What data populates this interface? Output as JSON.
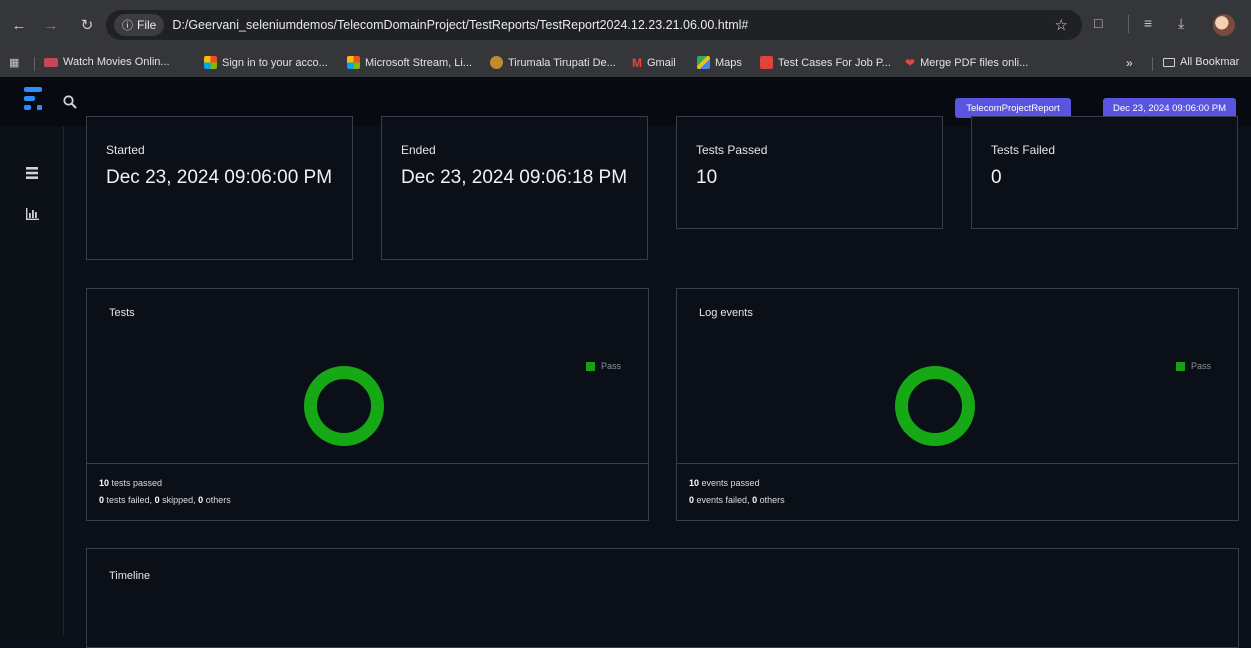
{
  "browser": {
    "file_chip": "File",
    "url": "D:/Geervani_seleniumdemos/TelecomDomainProject/TestReports/TestReport2024.12.23.21.06.00.html#",
    "bookmarks": [
      "Watch Movies Onlin...",
      "Sign in to your acco...",
      "Microsoft Stream, Li...",
      "Tirumala Tirupati De...",
      "Gmail",
      "Maps",
      "Test Cases For Job P...",
      "Merge PDF files onli..."
    ],
    "more_label": "»",
    "all_bookmarks": "All Bookmar"
  },
  "appbar": {
    "report_name": "TelecomProjectReport",
    "report_date": "Dec 23, 2024 09:06:00 PM"
  },
  "stats": {
    "started_label": "Started",
    "started_value": "Dec 23, 2024 09:06:00 PM",
    "ended_label": "Ended",
    "ended_value": "Dec 23, 2024 09:06:18 PM",
    "passed_label": "Tests Passed",
    "passed_value": "10",
    "failed_label": "Tests Failed",
    "failed_value": "0"
  },
  "tests_card": {
    "title": "Tests",
    "legend": "Pass",
    "passed_count": "10",
    "passed_text": "tests passed",
    "failed_count": "0",
    "failed_text": "tests failed,",
    "skipped_count": "0",
    "skipped_text": "skipped,",
    "others_count": "0",
    "others_text": "others"
  },
  "events_card": {
    "title": "Log events",
    "legend": "Pass",
    "passed_count": "10",
    "passed_text": "events passed",
    "failed_count": "0",
    "failed_text": "events failed,",
    "others_count": "0",
    "others_text": "others"
  },
  "timeline": {
    "title": "Timeline"
  },
  "colors": {
    "pass": "#16a815",
    "badge": "#5a55e0",
    "background": "#0b0f17"
  },
  "icons": [
    "back-icon",
    "forward-icon",
    "reload-icon",
    "info-icon",
    "star-icon",
    "extensions-icon",
    "reading-list-icon",
    "download-icon",
    "apps-icon",
    "folder-icon",
    "extent-logo-icon",
    "search-icon",
    "list-icon",
    "chart-icon"
  ]
}
